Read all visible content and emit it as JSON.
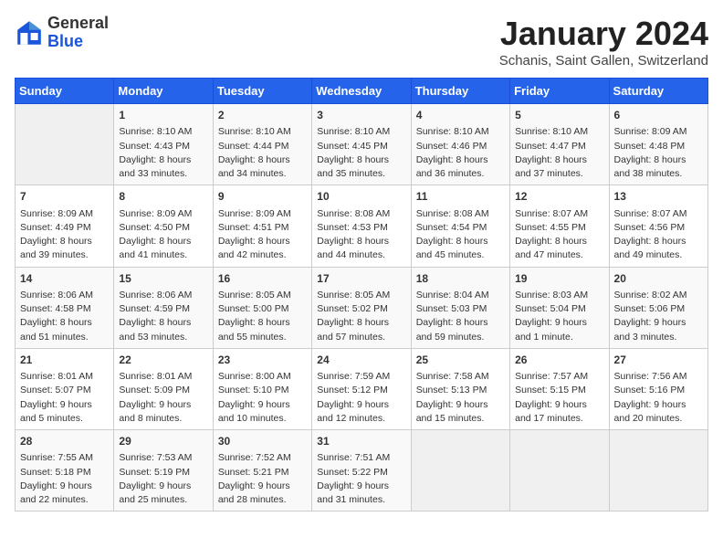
{
  "header": {
    "logo_general": "General",
    "logo_blue": "Blue",
    "month_title": "January 2024",
    "location": "Schanis, Saint Gallen, Switzerland"
  },
  "days_of_week": [
    "Sunday",
    "Monday",
    "Tuesday",
    "Wednesday",
    "Thursday",
    "Friday",
    "Saturday"
  ],
  "weeks": [
    [
      {
        "day": "",
        "data": ""
      },
      {
        "day": "1",
        "data": "Sunrise: 8:10 AM\nSunset: 4:43 PM\nDaylight: 8 hours\nand 33 minutes."
      },
      {
        "day": "2",
        "data": "Sunrise: 8:10 AM\nSunset: 4:44 PM\nDaylight: 8 hours\nand 34 minutes."
      },
      {
        "day": "3",
        "data": "Sunrise: 8:10 AM\nSunset: 4:45 PM\nDaylight: 8 hours\nand 35 minutes."
      },
      {
        "day": "4",
        "data": "Sunrise: 8:10 AM\nSunset: 4:46 PM\nDaylight: 8 hours\nand 36 minutes."
      },
      {
        "day": "5",
        "data": "Sunrise: 8:10 AM\nSunset: 4:47 PM\nDaylight: 8 hours\nand 37 minutes."
      },
      {
        "day": "6",
        "data": "Sunrise: 8:09 AM\nSunset: 4:48 PM\nDaylight: 8 hours\nand 38 minutes."
      }
    ],
    [
      {
        "day": "7",
        "data": "Sunrise: 8:09 AM\nSunset: 4:49 PM\nDaylight: 8 hours\nand 39 minutes."
      },
      {
        "day": "8",
        "data": "Sunrise: 8:09 AM\nSunset: 4:50 PM\nDaylight: 8 hours\nand 41 minutes."
      },
      {
        "day": "9",
        "data": "Sunrise: 8:09 AM\nSunset: 4:51 PM\nDaylight: 8 hours\nand 42 minutes."
      },
      {
        "day": "10",
        "data": "Sunrise: 8:08 AM\nSunset: 4:53 PM\nDaylight: 8 hours\nand 44 minutes."
      },
      {
        "day": "11",
        "data": "Sunrise: 8:08 AM\nSunset: 4:54 PM\nDaylight: 8 hours\nand 45 minutes."
      },
      {
        "day": "12",
        "data": "Sunrise: 8:07 AM\nSunset: 4:55 PM\nDaylight: 8 hours\nand 47 minutes."
      },
      {
        "day": "13",
        "data": "Sunrise: 8:07 AM\nSunset: 4:56 PM\nDaylight: 8 hours\nand 49 minutes."
      }
    ],
    [
      {
        "day": "14",
        "data": "Sunrise: 8:06 AM\nSunset: 4:58 PM\nDaylight: 8 hours\nand 51 minutes."
      },
      {
        "day": "15",
        "data": "Sunrise: 8:06 AM\nSunset: 4:59 PM\nDaylight: 8 hours\nand 53 minutes."
      },
      {
        "day": "16",
        "data": "Sunrise: 8:05 AM\nSunset: 5:00 PM\nDaylight: 8 hours\nand 55 minutes."
      },
      {
        "day": "17",
        "data": "Sunrise: 8:05 AM\nSunset: 5:02 PM\nDaylight: 8 hours\nand 57 minutes."
      },
      {
        "day": "18",
        "data": "Sunrise: 8:04 AM\nSunset: 5:03 PM\nDaylight: 8 hours\nand 59 minutes."
      },
      {
        "day": "19",
        "data": "Sunrise: 8:03 AM\nSunset: 5:04 PM\nDaylight: 9 hours\nand 1 minute."
      },
      {
        "day": "20",
        "data": "Sunrise: 8:02 AM\nSunset: 5:06 PM\nDaylight: 9 hours\nand 3 minutes."
      }
    ],
    [
      {
        "day": "21",
        "data": "Sunrise: 8:01 AM\nSunset: 5:07 PM\nDaylight: 9 hours\nand 5 minutes."
      },
      {
        "day": "22",
        "data": "Sunrise: 8:01 AM\nSunset: 5:09 PM\nDaylight: 9 hours\nand 8 minutes."
      },
      {
        "day": "23",
        "data": "Sunrise: 8:00 AM\nSunset: 5:10 PM\nDaylight: 9 hours\nand 10 minutes."
      },
      {
        "day": "24",
        "data": "Sunrise: 7:59 AM\nSunset: 5:12 PM\nDaylight: 9 hours\nand 12 minutes."
      },
      {
        "day": "25",
        "data": "Sunrise: 7:58 AM\nSunset: 5:13 PM\nDaylight: 9 hours\nand 15 minutes."
      },
      {
        "day": "26",
        "data": "Sunrise: 7:57 AM\nSunset: 5:15 PM\nDaylight: 9 hours\nand 17 minutes."
      },
      {
        "day": "27",
        "data": "Sunrise: 7:56 AM\nSunset: 5:16 PM\nDaylight: 9 hours\nand 20 minutes."
      }
    ],
    [
      {
        "day": "28",
        "data": "Sunrise: 7:55 AM\nSunset: 5:18 PM\nDaylight: 9 hours\nand 22 minutes."
      },
      {
        "day": "29",
        "data": "Sunrise: 7:53 AM\nSunset: 5:19 PM\nDaylight: 9 hours\nand 25 minutes."
      },
      {
        "day": "30",
        "data": "Sunrise: 7:52 AM\nSunset: 5:21 PM\nDaylight: 9 hours\nand 28 minutes."
      },
      {
        "day": "31",
        "data": "Sunrise: 7:51 AM\nSunset: 5:22 PM\nDaylight: 9 hours\nand 31 minutes."
      },
      {
        "day": "",
        "data": ""
      },
      {
        "day": "",
        "data": ""
      },
      {
        "day": "",
        "data": ""
      }
    ]
  ]
}
